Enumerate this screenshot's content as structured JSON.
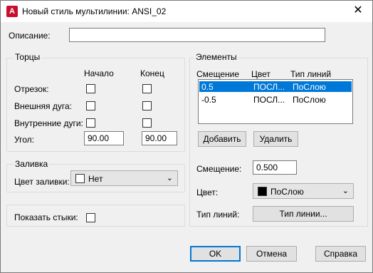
{
  "window": {
    "title": "Новый стиль мультилинии: ANSI_02",
    "app_icon_letter": "A",
    "close_glyph": "✕"
  },
  "description": {
    "label": "Описание:",
    "value": ""
  },
  "caps": {
    "group_title": "Торцы",
    "col_start": "Начало",
    "col_end": "Конец",
    "rows": [
      {
        "label": "Отрезок:",
        "start_checked": false,
        "end_checked": false
      },
      {
        "label": "Внешняя дуга:",
        "start_checked": false,
        "end_checked": false
      },
      {
        "label": "Внутренние дуги:",
        "start_checked": false,
        "end_checked": false
      }
    ],
    "angle_label": "Угол:",
    "angle_start": "90.00",
    "angle_end": "90.00"
  },
  "fill": {
    "group_title": "Заливка",
    "color_label": "Цвет заливки:",
    "color_value": "Нет",
    "swatch_color": "#ffffff"
  },
  "joints": {
    "label": "Показать стыки:",
    "checked": false
  },
  "elements": {
    "group_title": "Элементы",
    "headers": [
      "Смещение",
      "Цвет",
      "Тип линий"
    ],
    "rows": [
      {
        "offset": "0.5",
        "color": "ПОСЛ...",
        "linetype": "ПоСлою",
        "selected": true
      },
      {
        "offset": "-0.5",
        "color": "ПОСЛ...",
        "linetype": "ПоСлою",
        "selected": false
      }
    ],
    "add_button": "Добавить",
    "delete_button": "Удалить",
    "offset_label": "Смещение:",
    "offset_value": "0.500",
    "color_label": "Цвет:",
    "color_value": "ПоСлою",
    "color_swatch": "#000000",
    "linetype_label": "Тип линий:",
    "linetype_button": "Тип линии..."
  },
  "footer": {
    "ok": "OK",
    "cancel": "Отмена",
    "help": "Справка"
  },
  "colors": {
    "selection": "#0078d7",
    "default_button_border": "#0078d7"
  }
}
